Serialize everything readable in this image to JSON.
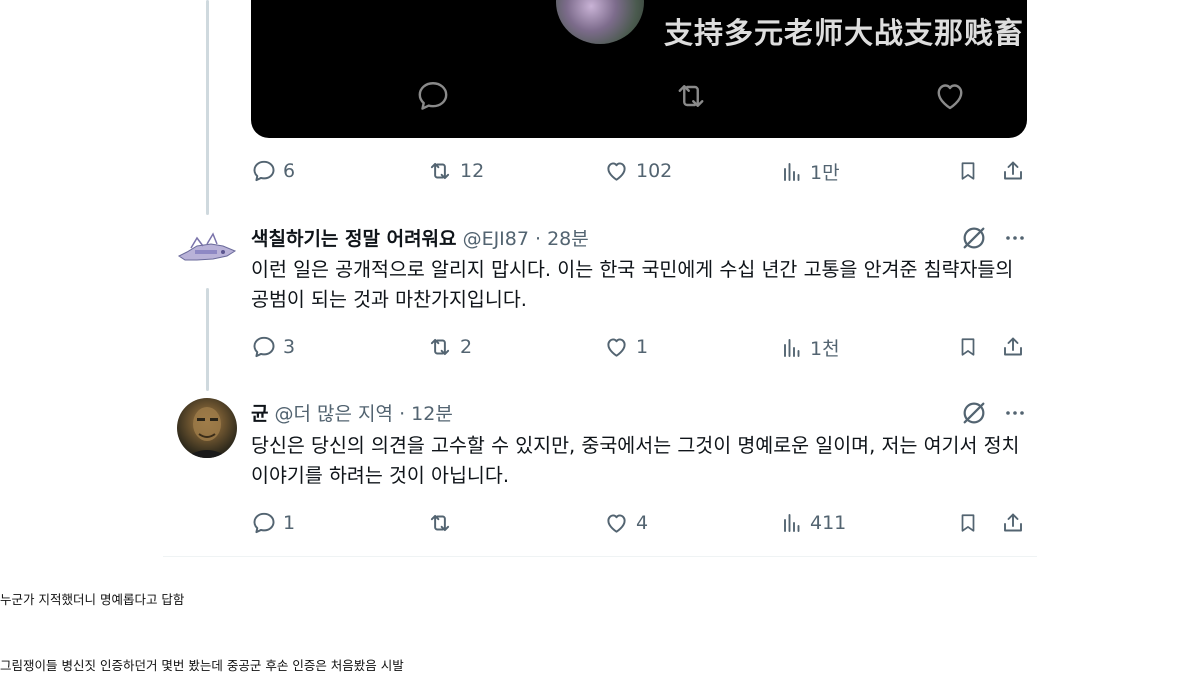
{
  "media": {
    "text": "支持多元老师大战支那贱畜"
  },
  "post0_actions": {
    "replies": "6",
    "reposts": "12",
    "likes": "102",
    "views": "1만"
  },
  "post1": {
    "name": "색칠하기는 정말 어려워요",
    "handle": "@EJI87",
    "separator": "·",
    "time": "28분",
    "body": "이런 일은 공개적으로 알리지 맙시다. 이는 한국 국민에게 수십 년간 고통을 안겨준 침략자들의 공범이 되는 것과 마찬가지입니다.",
    "replies": "3",
    "reposts": "2",
    "likes": "1",
    "views": "1천"
  },
  "post2": {
    "name": "균",
    "handle": "@더 많은 지역",
    "separator": "·",
    "time": "12분",
    "body": "당신은 당신의 의견을 고수할 수 있지만, 중국에서는 그것이 명예로운 일이며, 저는 여기서 정치 이야기를 하려는 것이 아닙니다.",
    "replies": "1",
    "reposts": "",
    "likes": "4",
    "views": "411"
  },
  "captions": [
    "누군가 지적했더니 명예롭다고 답함",
    "그림쟁이들 병신짓 인증하던거 몇번 봤는데 중공군 후손 인증은 처음봤음 시발"
  ],
  "colors": {
    "muted": "#536471",
    "text": "#0f1419",
    "thread_line": "#cfd9de"
  }
}
